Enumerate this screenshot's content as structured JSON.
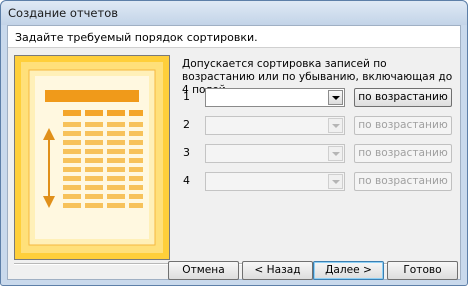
{
  "window": {
    "title": "Создание отчетов"
  },
  "header": {
    "instruction": "Задайте требуемый порядок сортировки."
  },
  "description": "Допускается сортировка записей по возрастанию или по убыванию, включающая до 4 полей.",
  "sort_rows": [
    {
      "number": "1",
      "field_value": "",
      "order_label": "по возрастанию",
      "enabled": true
    },
    {
      "number": "2",
      "field_value": "",
      "order_label": "по возрастанию",
      "enabled": false
    },
    {
      "number": "3",
      "field_value": "",
      "order_label": "по возрастанию",
      "enabled": false
    },
    {
      "number": "4",
      "field_value": "",
      "order_label": "по возрастанию",
      "enabled": false
    }
  ],
  "buttons": {
    "cancel": "Отмена",
    "back": "< Назад",
    "next": "Далее >",
    "finish": "Готово"
  },
  "colors": {
    "illustration_bg": "#ffd44a",
    "illustration_accent": "#f0a21c"
  }
}
